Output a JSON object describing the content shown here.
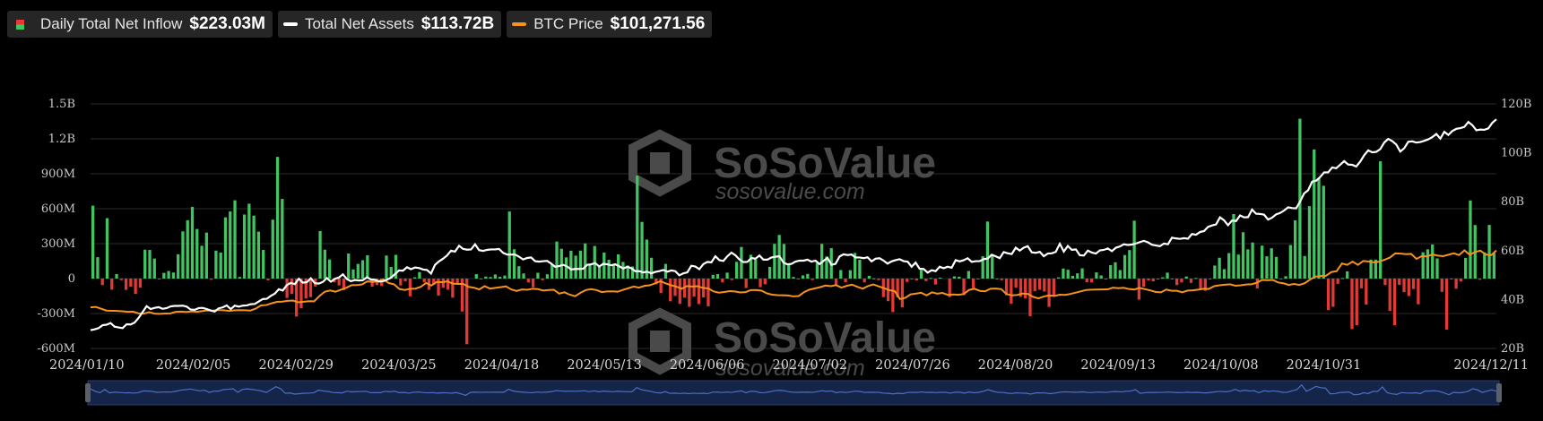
{
  "legend": {
    "inflow": {
      "label": "Daily Total Net Inflow",
      "value": "$223.03M",
      "color": "#43c463",
      "neg_color": "#e53935"
    },
    "assets": {
      "label": "Total Net Assets",
      "value": "$113.72B",
      "color": "#ffffff"
    },
    "btc": {
      "label": "BTC Price",
      "value": "$101,271.56",
      "color": "#f7931a"
    }
  },
  "watermark": {
    "brand": "SoSoValue",
    "site": "sosovalue.com"
  },
  "chart_data": {
    "type": "bar+line",
    "y_left": {
      "ticks": [
        "1.5B",
        "1.2B",
        "900M",
        "600M",
        "300M",
        "0",
        "-300M",
        "-600M"
      ],
      "range_m": [
        -600,
        1500
      ]
    },
    "y_right": {
      "ticks": [
        "120B",
        "100B",
        "80B",
        "60B",
        "40B",
        "20B"
      ],
      "range_b": [
        20,
        120
      ]
    },
    "x_labels": [
      "2024/01/10",
      "2024/02/05",
      "2024/02/29",
      "2024/03/25",
      "2024/04/18",
      "2024/05/13",
      "2024/06/06",
      "2024/07/02",
      "2024/07/26",
      "2024/08/20",
      "2024/09/13",
      "2024/10/08",
      "2024/10/31",
      "2024/12/11"
    ],
    "x_label_fracs": [
      0.0,
      0.0731,
      0.1462,
      0.2193,
      0.2924,
      0.3655,
      0.4386,
      0.5117,
      0.5848,
      0.6579,
      0.731,
      0.8041,
      0.8772,
      1.0
    ],
    "daily_net_inflow_m": [
      626,
      184,
      -56,
      519,
      -95,
      39,
      -13,
      -97,
      -70,
      -132,
      -77,
      248,
      246,
      172,
      -3,
      49,
      65,
      52,
      209,
      405,
      501,
      616,
      426,
      282,
      395,
      -10,
      240,
      223,
      526,
      576,
      672,
      14,
      550,
      643,
      541,
      403,
      246,
      -15,
      506,
      1045,
      684,
      -166,
      -132,
      -326,
      -255,
      -171,
      -159,
      -68,
      408,
      248,
      164,
      -31,
      -59,
      -99,
      215,
      79,
      126,
      158,
      200,
      -70,
      -56,
      -63,
      198,
      100,
      204,
      -59,
      -24,
      -152,
      11,
      56,
      -32,
      -96,
      -53,
      -146,
      -78,
      -96,
      -164,
      -47,
      -283,
      -564,
      0,
      38,
      -7,
      17,
      13,
      35,
      15,
      26,
      576,
      252,
      106,
      44,
      -33,
      -75,
      50,
      -14,
      37,
      122,
      318,
      256,
      182,
      239,
      197,
      240,
      302,
      118,
      280,
      101,
      223,
      161,
      118,
      208,
      143,
      112,
      104,
      884,
      487,
      335,
      179,
      -49,
      -123,
      126,
      -195,
      -149,
      -217,
      -164,
      -242,
      -155,
      -219,
      -162,
      -238,
      32,
      38,
      -33,
      51,
      -13,
      144,
      272,
      -81,
      205,
      164,
      -74,
      -49,
      100,
      298,
      375,
      297,
      119,
      14,
      -5,
      27,
      40,
      -13,
      134,
      298,
      190,
      261,
      -56,
      73,
      -31,
      72,
      220,
      162,
      -33,
      23,
      2,
      -13,
      -159,
      -194,
      -288,
      -162,
      -246,
      -29,
      -3,
      -16,
      74,
      -22,
      5,
      -51,
      8,
      0,
      -159,
      19,
      16,
      -142,
      65,
      -82,
      -1,
      192,
      490,
      210,
      -8,
      -14,
      -143,
      -216,
      -78,
      -157,
      -169,
      -323,
      -107,
      -96,
      -111,
      -243,
      -155,
      10,
      86,
      76,
      23,
      45,
      88,
      -31,
      -33,
      53,
      27,
      -8,
      115,
      140,
      73,
      202,
      245,
      497,
      -181,
      -71,
      -16,
      -24,
      -8,
      11,
      51,
      -4,
      -56,
      -33,
      18,
      -37,
      5,
      -85,
      -105,
      -2,
      112,
      179,
      81,
      219,
      554,
      206,
      398,
      251,
      310,
      -85,
      283,
      191,
      260,
      186,
      -4,
      20,
      288,
      500,
      1373,
      194,
      622,
      1109,
      861,
      797,
      -271,
      -242,
      -45,
      4,
      62,
      -434,
      -400,
      -84,
      -223,
      163,
      163,
      1007,
      -56,
      -277,
      -400,
      -54,
      -117,
      -150,
      -90,
      -221,
      226,
      251,
      293,
      173,
      -114,
      -438,
      -1,
      -87,
      -25,
      178,
      671,
      460,
      -10,
      225,
      461,
      219
    ],
    "total_net_assets_b": [
      27.5,
      27.8,
      28.3,
      29.5,
      29.7,
      30.4,
      28.9,
      28.6,
      28.3,
      29.9,
      29.8,
      30.6,
      32.5,
      34.9,
      37.3,
      36.1,
      36.6,
      36.9,
      36.2,
      36.5,
      37.2,
      37.4,
      37.4,
      37.5,
      37.1,
      35.9,
      35.8,
      36.5,
      36.6,
      36.1,
      35.5,
      35.1,
      36.4,
      36.8,
      37.6,
      36.1,
      37.5,
      37.1,
      37.5,
      37.6,
      38.1,
      38.2,
      39.2,
      40.2,
      40.3,
      41.5,
      42.4,
      44.2,
      43.7,
      45.9,
      46.8,
      46.3,
      48.5,
      46.9,
      47.1,
      48.7,
      46.7,
      46.5,
      47.2,
      48.8,
      47.3,
      48.5,
      49.0,
      50.3,
      48.4,
      47.5,
      48.0,
      47.8,
      47.9,
      49.1,
      48.2,
      48.1,
      47.4,
      47.5,
      48.1,
      48.9,
      50.4,
      51.9,
      51.8,
      53.2,
      52.4,
      53.1,
      52.9,
      52.3,
      52.1,
      50.6,
      54.2,
      55.6,
      56.7,
      58.0,
      60.0,
      59.6,
      62.0,
      60.7,
      60.4,
      60.5,
      62.6,
      60.2,
      59.9,
      60.3,
      60.5,
      60.5,
      60.7,
      59.1,
      58.4,
      58.4,
      58.4,
      57.5,
      56.4,
      57.0,
      57.2,
      55.7,
      55.5,
      55.7,
      55.8,
      54.7,
      53.4,
      53.7,
      54.2,
      53.5,
      52.3,
      52.5,
      52.5,
      52.6,
      54.2,
      54.4,
      54.9,
      53.5,
      54.6,
      54.4,
      54.0,
      54.4,
      53.6,
      52.7,
      53.4,
      52.8,
      51.6,
      51.6,
      51.1,
      51.4,
      50.7,
      51.3,
      51.6,
      52.1,
      51.4,
      51.9,
      51.6,
      49.9,
      50.7,
      51.1,
      53.8,
      53.5,
      52.4,
      54.5,
      55.4,
      55.2,
      57.7,
      56.1,
      55.8,
      57.7,
      59.2,
      58.1,
      56.4,
      55.3,
      55.4,
      57.0,
      56.7,
      58.0,
      56.3,
      56.3,
      57.2,
      57.5,
      57.7,
      55.1,
      54.4,
      54.6,
      55.5,
      55.9,
      55.9,
      56.3,
      55.5,
      55.9,
      54.5,
      55.8,
      57.0,
      54.2,
      54.6,
      57.6,
      58.5,
      58.2,
      58.4,
      57.2,
      57.2,
      56.9,
      57.3,
      55.6,
      56.7,
      56.9,
      55.9,
      54.7,
      55.6,
      56.1,
      56.5,
      55.7,
      55.5,
      53.4,
      55.1,
      52.6,
      52.5,
      51.0,
      52.0,
      51.6,
      53.4,
      52.8,
      53.4,
      53.0,
      56.1,
      55.6,
      56.1,
      56.9,
      55.4,
      55.7,
      55.7,
      56.5,
      56.8,
      58.3,
      57.7,
      56.9,
      59.4,
      58.9,
      58.6,
      61.2,
      60.0,
      61.2,
      61.8,
      59.3,
      59.1,
      59.5,
      57.7,
      58.8,
      58.9,
      59.5,
      62.8,
      59.6,
      61.9,
      60.3,
      60.5,
      58.1,
      58.0,
      60.0,
      59.2,
      58.8,
      60.1,
      60.3,
      60.9,
      59.8,
      61.2,
      61.7,
      62.6,
      62.3,
      62.5,
      62.9,
      63.5,
      64.0,
      63.4,
      62.4,
      62.1,
      61.8,
      62.9,
      62.6,
      65.3,
      65.0,
      64.8,
      65.1,
      64.9,
      66.8,
      66.5,
      67.6,
      68.0,
      69.7,
      70.3,
      70.7,
      73.6,
      72.4,
      70.4,
      72.3,
      72.1,
      74.4,
      73.6,
      73.7,
      76.8,
      75.1,
      75.0,
      74.7,
      72.7,
      73.5,
      74.8,
      75.4,
      76.4,
      77.7,
      77.4,
      77.3,
      80.1,
      83.4,
      84.7,
      88.2,
      88.6,
      90.1,
      92.0,
      92.0,
      94.0,
      93.7,
      95.1,
      96.6,
      95.2,
      95.1,
      94.4,
      96.4,
      99.0,
      101.0,
      100.2,
      100.4,
      101.5,
      104.2,
      105.7,
      104.8,
      103.4,
      100.5,
      101.9,
      104.5,
      104.7,
      104.2,
      104.4,
      104.9,
      105.5,
      106.4,
      107.7,
      105.8,
      108.6,
      107.3,
      108.9,
      109.8,
      110.1,
      110.6,
      112.6,
      111.3,
      109.2,
      109.5,
      109.4,
      110.0,
      112.3,
      113.7
    ],
    "btc_price_k": [
      46,
      46.4,
      44.6,
      42.8,
      42.6,
      42.5,
      42.1,
      41.6,
      41.8,
      40.1,
      39.9,
      41.2,
      39.9,
      39.6,
      40,
      40.1,
      41.6,
      41.8,
      41.5,
      42,
      41.6,
      42.4,
      43,
      42.8,
      43.3,
      43.1,
      42.5,
      43,
      43.2,
      43.1,
      42.8,
      44.7,
      47.8,
      48.2,
      49.9,
      51.3,
      51.5,
      52.3,
      52.6,
      50.9,
      51.4,
      52,
      51.9,
      57.1,
      61.2,
      62.4,
      61.2,
      63.1,
      65,
      67.5,
      67.6,
      68.3,
      71.3,
      70.7,
      71.4,
      73.1,
      69.6,
      68.4,
      63.8,
      62.9,
      64,
      64.2,
      65.9,
      69.7,
      67.2,
      70.7,
      70.4,
      71.3,
      69.1,
      68.8,
      68.8,
      65.9,
      65.1,
      63.4,
      66.7,
      64.2,
      64.9,
      65.6,
      66.4,
      63.4,
      61.9,
      63.4,
      63.1,
      64.1,
      63.7,
      62.3,
      62.9,
      63.1,
      59.3,
      60.6,
      58.3,
      56.8,
      60.1,
      62.8,
      63.7,
      62.8,
      60.8,
      61.4,
      61.5,
      61.2,
      63,
      64.6,
      66.2,
      65.2,
      66.9,
      67.4,
      69.3,
      71.4,
      69.3,
      67.5,
      66.2,
      64,
      66.7,
      66.2,
      66.6,
      64.9,
      64.4,
      61.5,
      60.3,
      60.9,
      61.8,
      61.4,
      60.5,
      60.8,
      62.8,
      62.9,
      62.2,
      59.6,
      58.3,
      57.9,
      57.7,
      57.5,
      56.6,
      57,
      60.8,
      63.2,
      64.4,
      65.6,
      67.2,
      66.6,
      67.6,
      65.2,
      66.9,
      68.1,
      66,
      64.1,
      66.7,
      68.3,
      66.4,
      64.7,
      62.7,
      61.8,
      54,
      55.3,
      58.6,
      59.4,
      60.1,
      57.6,
      60.6,
      59.3,
      60,
      58.1,
      58.5,
      58.2,
      59,
      63,
      64,
      62,
      61.6,
      64.1,
      64.3,
      63.7,
      59,
      57.6,
      58,
      59.4,
      59.1,
      56.2,
      54.7,
      56.5,
      57.6,
      57.1,
      58.3,
      58.1,
      59,
      60.3,
      61.6,
      62.9,
      63.2,
      63.3,
      63.4,
      63.5,
      65.1,
      64.6,
      65,
      63.8,
      63.3,
      64.9,
      63.7,
      62.5,
      61,
      60.6,
      63.3,
      62.1,
      62.1,
      60.6,
      62.3,
      62.5,
      63.2,
      64.1,
      63.9,
      66.6,
      67.4,
      68,
      68.4,
      67,
      67.4,
      68.2,
      68.4,
      69.9,
      72.7,
      72.3,
      72.7,
      70.2,
      69.4,
      67.8,
      68.7,
      67.8,
      69.4,
      73,
      75.9,
      76.5,
      76.7,
      80.3,
      81.2,
      88.7,
      87.3,
      90.5,
      87.3,
      91.1,
      90.6,
      89.8,
      90.4,
      92.3,
      94.4,
      98.5,
      98.3,
      97.7,
      98,
      93.1,
      95.9,
      95.6,
      97.5,
      96.3,
      95.8,
      97.2,
      98.6,
      96.9,
      101.5,
      97.2,
      99.9,
      101.2,
      97.4,
      96.7,
      101.3
    ]
  }
}
